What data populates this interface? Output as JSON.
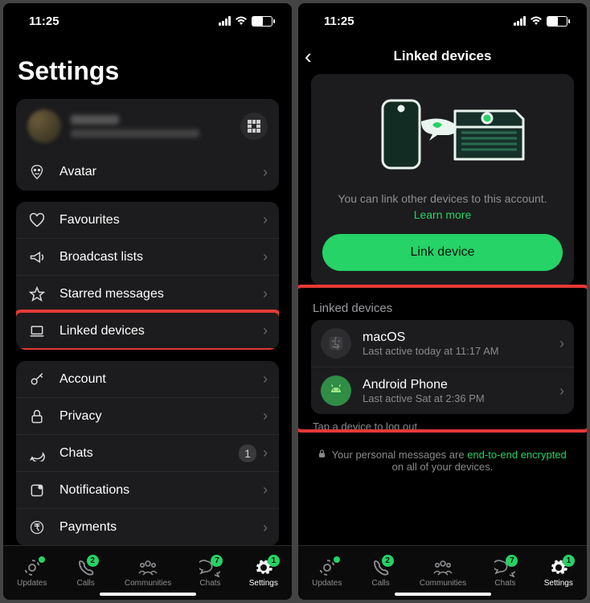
{
  "status": {
    "time": "11:25"
  },
  "phone1": {
    "title": "Settings",
    "avatarRow": "Avatar",
    "groupA": [
      {
        "name": "favourites",
        "label": "Favourites"
      },
      {
        "name": "broadcast",
        "label": "Broadcast lists"
      },
      {
        "name": "starred",
        "label": "Starred messages"
      },
      {
        "name": "linked",
        "label": "Linked devices"
      }
    ],
    "groupB": [
      {
        "name": "account",
        "label": "Account"
      },
      {
        "name": "privacy",
        "label": "Privacy"
      },
      {
        "name": "chats-setting",
        "label": "Chats",
        "badge": "1"
      },
      {
        "name": "notifications",
        "label": "Notifications"
      },
      {
        "name": "payments",
        "label": "Payments"
      }
    ]
  },
  "phone2": {
    "header": "Linked devices",
    "illusText": "You can link other devices to this account.",
    "learnMore": "Learn more",
    "linkBtn": "Link device",
    "sectionLabel": "Linked devices",
    "devices": [
      {
        "key": "macos",
        "name": "macOS",
        "sub": "Last active today at 11:17 AM"
      },
      {
        "key": "android",
        "name": "Android Phone",
        "sub": "Last active Sat at 2:36 PM"
      }
    ],
    "caption": "Tap a device to log out.",
    "encPre": "Your personal messages are ",
    "encLink": "end-to-end encrypted",
    "encPost": "on all of your devices."
  },
  "tabs": [
    {
      "key": "updates",
      "label": "Updates",
      "dot": true
    },
    {
      "key": "calls",
      "label": "Calls",
      "badge": "2"
    },
    {
      "key": "communities",
      "label": "Communities"
    },
    {
      "key": "chats",
      "label": "Chats",
      "badge": "7"
    },
    {
      "key": "settings",
      "label": "Settings",
      "badge": "1",
      "active": true
    }
  ]
}
